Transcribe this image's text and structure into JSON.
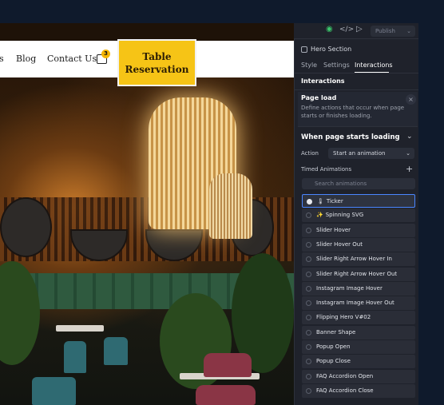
{
  "site": {
    "nav": [
      "s",
      "Blog",
      "Contact Us"
    ],
    "cart_count": "3",
    "cta_line1": "Table",
    "cta_line2": "Reservation"
  },
  "toolbar": {
    "publish_label": "Publish"
  },
  "panel": {
    "element_name": "Hero Section",
    "tabs": [
      "Style",
      "Settings",
      "Interactions"
    ],
    "active_tab": "Interactions",
    "section_heading": "Interactions",
    "page_load": {
      "title": "Page load",
      "description_line1": "Define actions that occur when page",
      "description_line2": "starts or finishes loading."
    },
    "trigger": {
      "title": "When page starts loading",
      "action_label": "Action",
      "action_value": "Start an animation"
    },
    "timed": {
      "title": "Timed Animations",
      "search_placeholder": "Search animations"
    },
    "animations": [
      {
        "label": "Ticker",
        "glyph": "🌡",
        "selected": true
      },
      {
        "label": "Spinning SVG",
        "glyph": "✨",
        "selected": false
      },
      {
        "label": "Slider Hover",
        "glyph": "",
        "selected": false
      },
      {
        "label": "Slider Hover Out",
        "glyph": "",
        "selected": false
      },
      {
        "label": "Slider Right Arrow Hover In",
        "glyph": "",
        "selected": false
      },
      {
        "label": "Slider Right Arrow Hover Out",
        "glyph": "",
        "selected": false
      },
      {
        "label": "Instagram Image Hover",
        "glyph": "",
        "selected": false
      },
      {
        "label": "Instagram Image Hover Out",
        "glyph": "",
        "selected": false
      },
      {
        "label": "Flipping Hero V#02",
        "glyph": "",
        "selected": false
      },
      {
        "label": "Banner Shape",
        "glyph": "",
        "selected": false
      },
      {
        "label": "Popup Open",
        "glyph": "",
        "selected": false
      },
      {
        "label": "Popup Close",
        "glyph": "",
        "selected": false
      },
      {
        "label": "FAQ Accordion Open",
        "glyph": "",
        "selected": false
      },
      {
        "label": "FAQ Accordion Close",
        "glyph": "",
        "selected": false
      }
    ]
  },
  "colors": {
    "accent": "#f6c416",
    "panel_bg": "#1f222b",
    "selection": "#4a86ff"
  }
}
